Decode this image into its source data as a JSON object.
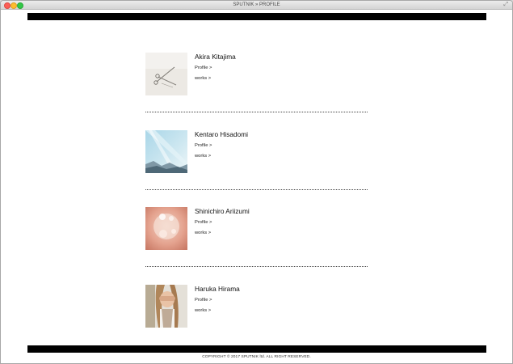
{
  "window": {
    "title": "SPUTNIK » PROFILE"
  },
  "artists": [
    {
      "name": "Akira Kitajima",
      "profile_label": "Profile >",
      "works_label": "works >",
      "thumb": "scissors-photo"
    },
    {
      "name": "Kentaro Hisadomi",
      "profile_label": "Profile >",
      "works_label": "works >",
      "thumb": "blue-light-photo"
    },
    {
      "name": "Shinichiro Ariizumi",
      "profile_label": "Profile >",
      "works_label": "works >",
      "thumb": "pink-bokeh-photo"
    },
    {
      "name": "Haruka Hirama",
      "profile_label": "Profile >",
      "works_label": "works >",
      "thumb": "portrait-photo"
    }
  ],
  "footer": {
    "copyright": "COPYRIGHT © 2017 SPUTNIK ltd. ALL RIGHT RESERVED."
  }
}
